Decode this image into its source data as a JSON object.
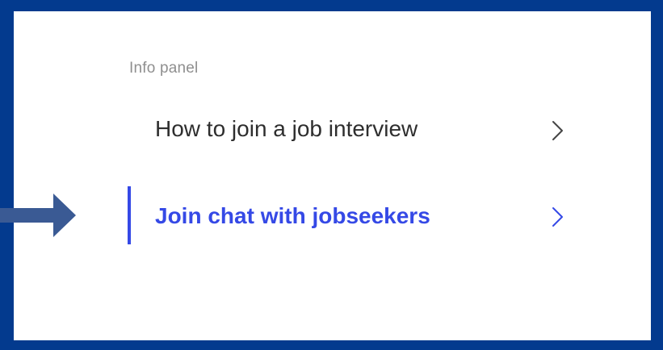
{
  "info_panel": {
    "title": "Info panel",
    "items": [
      {
        "label": "How to join a job interview",
        "icon": "chevron-right-icon",
        "active": false
      },
      {
        "label": "Join chat with jobseekers",
        "icon": "chevron-right-icon",
        "active": true
      }
    ]
  },
  "colors": {
    "frame_border": "#033a8e",
    "accent": "#3549e6",
    "arrow": "#3a5a94",
    "title_text": "#8f8f8f",
    "item_text": "#2e2e2e"
  },
  "annotation": {
    "icon": "right-arrow-pointer-icon"
  }
}
